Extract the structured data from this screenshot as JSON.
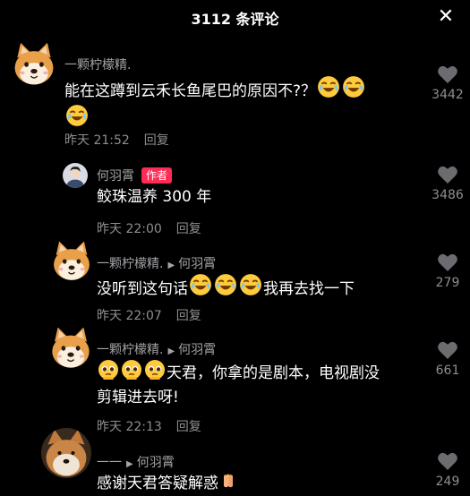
{
  "header": {
    "title": "3112 条评论",
    "close_icon": "close-icon"
  },
  "comments": [
    {
      "username": "一颗柠檬精.",
      "text": "能在这蹲到云禾长鱼尾巴的原因不?？",
      "time": "昨天 21:52",
      "reply_label": "回复",
      "likes": "3442",
      "avatar": "shiba-dog-avatar"
    },
    {
      "username": "何羽霄",
      "badge": "作者",
      "text": "鲛珠温养 300 年",
      "time": "昨天 22:00",
      "reply_label": "回复",
      "likes": "3486",
      "avatar": "person-avatar"
    },
    {
      "username": "一颗柠檬精.",
      "reply_to": "何羽霄",
      "text_before": "没听到这句话",
      "text_after": "我再去找一下",
      "time": "昨天 22:07",
      "reply_label": "回复",
      "likes": "279",
      "avatar": "shiba-dog-avatar"
    },
    {
      "username": "一颗柠檬精.",
      "reply_to": "何羽霄",
      "text_line1": "天君，你拿的是剧本，电视剧没",
      "text_line2": "剪辑进去呀!",
      "time": "昨天 22:13",
      "reply_label": "回复",
      "likes": "661",
      "avatar": "shiba-dog-avatar"
    },
    {
      "username": "一一",
      "reply_to": "何羽霄",
      "text": "感谢天君答疑解惑",
      "likes": "249",
      "avatar": "dog-photo-avatar"
    }
  ],
  "colors": {
    "background": "#000000",
    "badge": "#fe2c55",
    "secondary_text": "#8e8e93"
  }
}
